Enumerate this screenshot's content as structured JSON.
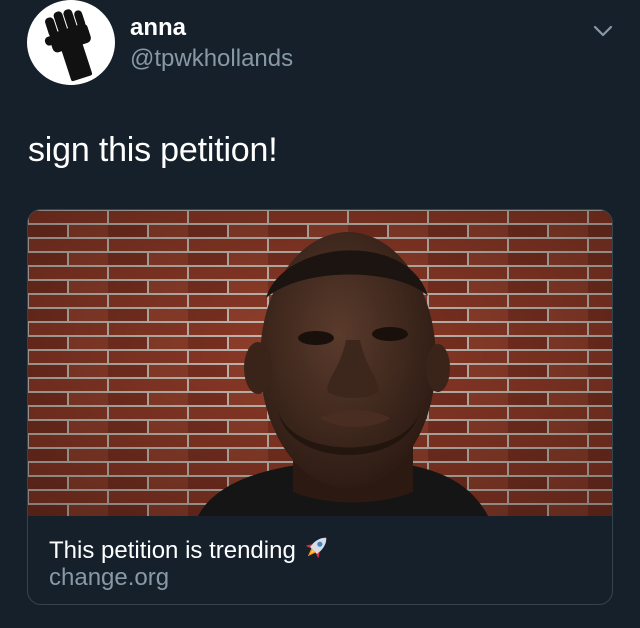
{
  "author": {
    "display_name": "anna",
    "handle": "@tpwkhollands",
    "avatar_icon": "raised-fist-icon"
  },
  "tweet": {
    "text": "sign this petition!"
  },
  "card": {
    "title": "This petition is trending",
    "title_emoji_icon": "rocket-icon",
    "domain": "change.org",
    "image": "photo of a man in front of a red brick wall"
  },
  "menu": {
    "icon": "chevron-down-icon"
  },
  "colors": {
    "background": "#15202b",
    "text_primary": "#ffffff",
    "text_secondary": "#8899a6",
    "card_border": "#38444d"
  }
}
